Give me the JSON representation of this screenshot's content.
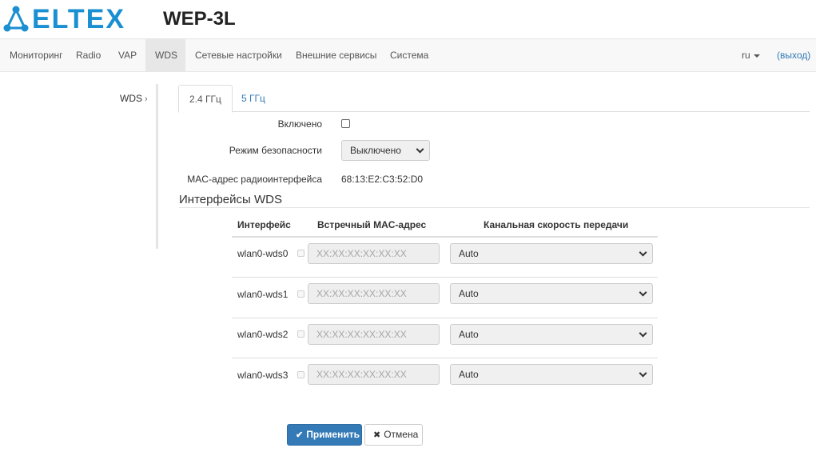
{
  "header": {
    "logo_text": "ELTEX",
    "device_title": "WEP-3L"
  },
  "nav": {
    "items": [
      {
        "label": "Мониторинг"
      },
      {
        "label": "Radio"
      },
      {
        "label": "VAP"
      },
      {
        "label": "WDS",
        "active": true
      },
      {
        "label": "Сетевые настройки"
      },
      {
        "label": "Внешние сервисы"
      },
      {
        "label": "Система"
      }
    ],
    "lang": "ru",
    "logout": "(выход)"
  },
  "side_menu": {
    "item": "WDS",
    "chevron": "›"
  },
  "tabs": [
    {
      "label": "2.4 ГГц",
      "active": true
    },
    {
      "label": "5 ГГц"
    }
  ],
  "form": {
    "enabled_label": "Включено",
    "enabled_checked": false,
    "security_label": "Режим безопасности",
    "security_value": "Выключено",
    "mac_label": "MAC-адрес радиоинтерфейса",
    "mac_value": "68:13:E2:C3:52:D0"
  },
  "wds": {
    "title": "Интерфейсы WDS",
    "columns": [
      "Интерфейс",
      "Встречный MAC-адрес",
      "Канальная скорость передачи"
    ],
    "rows": [
      {
        "name": "wlan0-wds0",
        "mac_placeholder": "XX:XX:XX:XX:XX:XX",
        "rate": "Auto"
      },
      {
        "name": "wlan0-wds1",
        "mac_placeholder": "XX:XX:XX:XX:XX:XX",
        "rate": "Auto"
      },
      {
        "name": "wlan0-wds2",
        "mac_placeholder": "XX:XX:XX:XX:XX:XX",
        "rate": "Auto"
      },
      {
        "name": "wlan0-wds3",
        "mac_placeholder": "XX:XX:XX:XX:XX:XX",
        "rate": "Auto"
      }
    ]
  },
  "buttons": {
    "apply": "Применить",
    "cancel": "Отмена"
  },
  "colors": {
    "brand": "#1a8fd2",
    "link": "#337ab7",
    "primary_button": "#337ab7"
  }
}
